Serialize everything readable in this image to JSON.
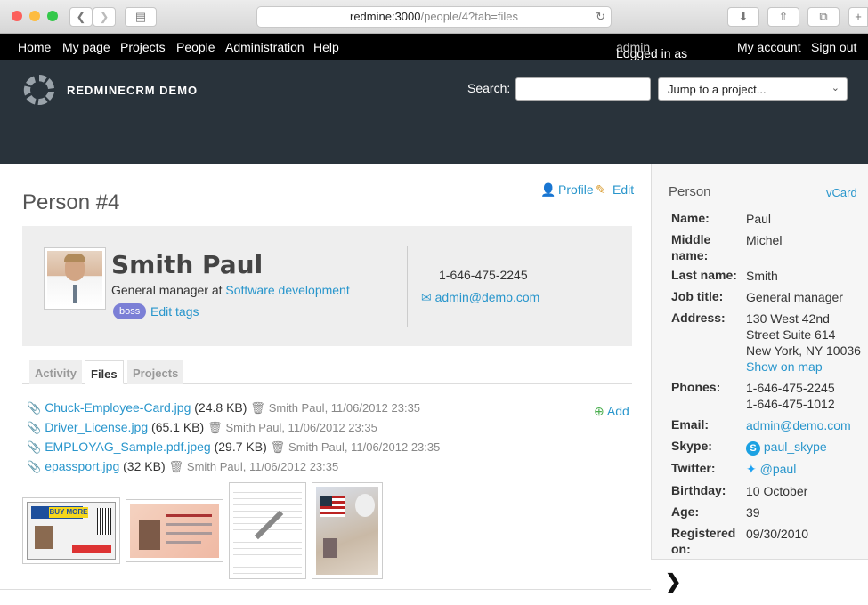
{
  "browser": {
    "url_host": "redmine:3000",
    "url_path": "/people/4?tab=files"
  },
  "top_menu": {
    "home": "Home",
    "my_page": "My page",
    "projects": "Projects",
    "people": "People",
    "administration": "Administration",
    "help": "Help",
    "logged_in_as": "Logged in as",
    "user": "admin",
    "my_account": "My account",
    "sign_out": "Sign out"
  },
  "header": {
    "site_title": "REDMINECRM DEMO",
    "search_label": "Search:",
    "jump_placeholder": "Jump to a project..."
  },
  "page": {
    "title": "Person #4",
    "profile_link": "Profile",
    "edit_link": "Edit"
  },
  "person_card": {
    "name": "Smith Paul",
    "job_prefix": "General manager at",
    "company": "Software development",
    "tag": "boss",
    "edit_tags": "Edit tags",
    "phone": "1-646-475-2245",
    "email": "admin@demo.com"
  },
  "tabs": {
    "activity": "Activity",
    "files": "Files",
    "projects": "Projects"
  },
  "files": [
    {
      "name": "Chuck-Employee-Card.jpg",
      "size": "(24.8 KB)",
      "meta": "Smith Paul, 11/06/2012 23:35"
    },
    {
      "name": "Driver_License.jpg",
      "size": "(65.1 KB)",
      "meta": "Smith Paul, 11/06/2012 23:35"
    },
    {
      "name": "EMPLOYAG_Sample.pdf.jpeg",
      "size": "(29.7 KB)",
      "meta": "Smith Paul, 11/06/2012 23:35"
    },
    {
      "name": "epassport.jpg",
      "size": "(32 KB)",
      "meta": "Smith Paul, 11/06/2012 23:35"
    }
  ],
  "add_label": "Add",
  "thumbnails": {
    "card_brand": "BUY MORE"
  },
  "sidebar": {
    "title": "Person",
    "vcard": "vCard",
    "name_label": "Name:",
    "name": "Paul",
    "middle_label": "Middle name:",
    "middle": "Michel",
    "last_label": "Last name:",
    "last": "Smith",
    "job_label": "Job title:",
    "job": "General manager",
    "address_label": "Address:",
    "address1": "130 West 42nd",
    "address2": "Street Suite 614",
    "address3": "New York, NY 10036",
    "show_on_map": "Show on map",
    "phones_label": "Phones:",
    "phone1": "1-646-475-2245",
    "phone2": "1-646-475-1012",
    "email_label": "Email:",
    "email": "admin@demo.com",
    "skype_label": "Skype:",
    "skype": "paul_skype",
    "twitter_label": "Twitter:",
    "twitter": "@paul",
    "birthday_label": "Birthday:",
    "birthday": "10 October",
    "age_label": "Age:",
    "age": "39",
    "registered_label": "Registered on:",
    "registered": "09/30/2010"
  },
  "colors": {
    "link": "#2996cc",
    "header_bg": "#29333b",
    "tag_bg": "#7b7fd6"
  }
}
